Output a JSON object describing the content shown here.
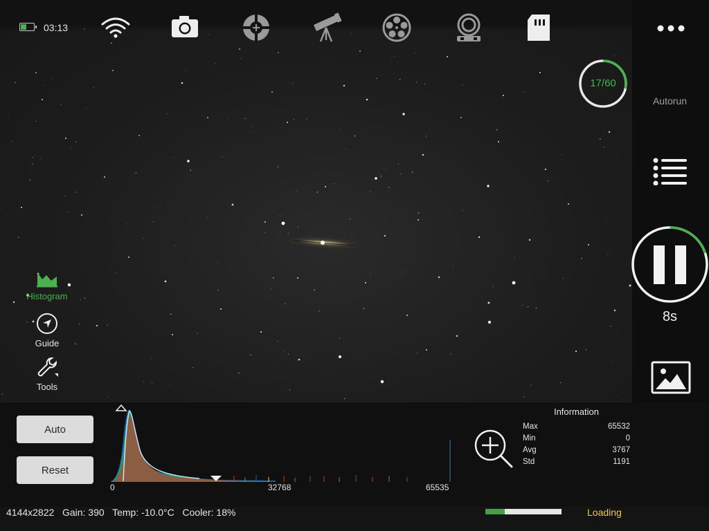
{
  "status": {
    "time": "03:13",
    "battery_level": 0.45
  },
  "toolbar": {
    "icons": [
      "wifi-icon",
      "camera-icon",
      "focuser-icon",
      "telescope-icon",
      "filter-wheel-icon",
      "guide-camera-icon",
      "sd-card-icon"
    ],
    "more_icon": "more-dots-icon"
  },
  "side": {
    "progress_label": "17/60",
    "progress_done": 17,
    "progress_total": 60,
    "autorun_label": "Autorun",
    "exposure_label": "8s",
    "exposure_progress": 0.2,
    "accent": "#4caf50"
  },
  "tools": [
    {
      "label": "Histogram",
      "icon": "histogram-icon",
      "active": true
    },
    {
      "label": "Guide",
      "icon": "navigation-arrow-icon",
      "active": false
    },
    {
      "label": "Tools",
      "icon": "wrench-icon",
      "active": false
    }
  ],
  "histogram": {
    "auto_label": "Auto",
    "reset_label": "Reset",
    "axis": [
      "0",
      "32768",
      "65535"
    ]
  },
  "info": {
    "title": "Information",
    "rows": [
      {
        "key": "Max",
        "value": "65532"
      },
      {
        "key": "Min",
        "value": "0"
      },
      {
        "key": "Avg",
        "value": "3767"
      },
      {
        "key": "Std",
        "value": "1191"
      }
    ]
  },
  "statusbar": {
    "text": "4144x2822   Gain: 390   Temp: -10.0°C   Cooler: 18%",
    "loading_label": "Loading",
    "loading_progress": 0.25,
    "loading_color": "#f2c94c"
  }
}
